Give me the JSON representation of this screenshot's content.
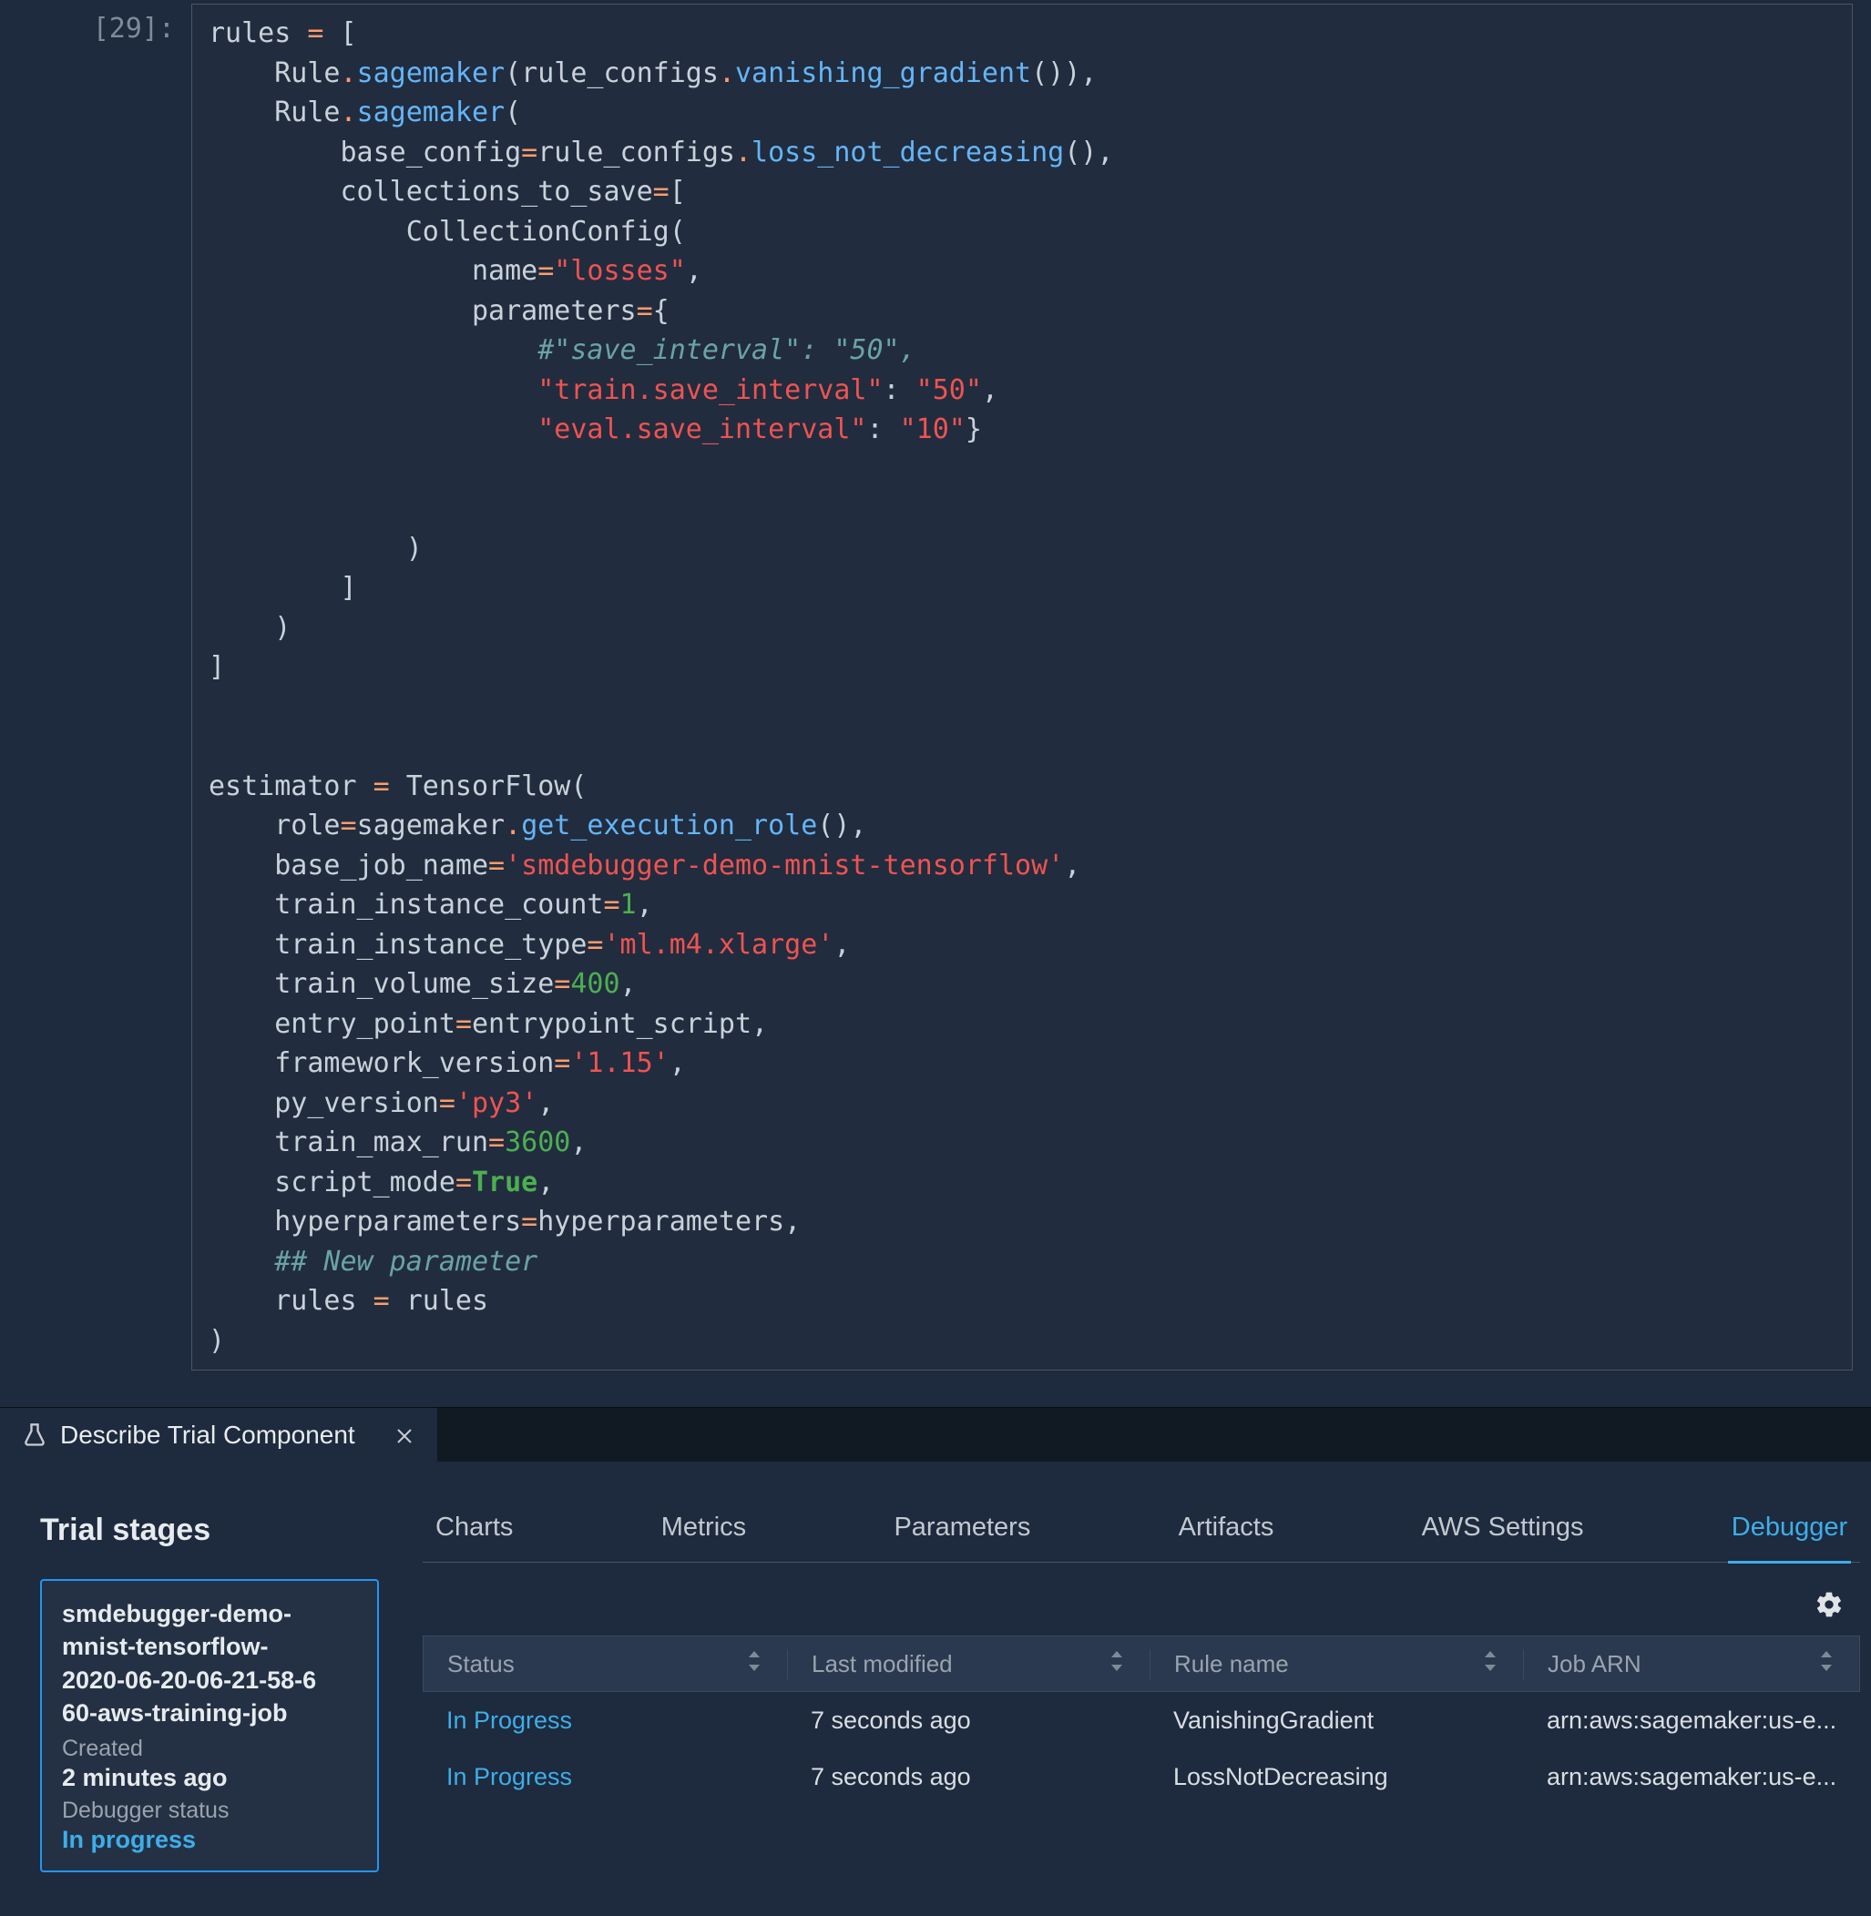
{
  "cell_prompt": "[29]:",
  "code_tokens": [
    [
      [
        "name",
        "rules "
      ],
      [
        "op",
        "="
      ],
      [
        "name",
        " ["
      ]
    ],
    [
      [
        "name",
        "    Rule"
      ],
      [
        "op",
        "."
      ],
      [
        "call",
        "sagemaker"
      ],
      [
        "name",
        "(rule_configs"
      ],
      [
        "op",
        "."
      ],
      [
        "call",
        "vanishing_gradient"
      ],
      [
        "name",
        "()),"
      ]
    ],
    [
      [
        "name",
        "    Rule"
      ],
      [
        "op",
        "."
      ],
      [
        "call",
        "sagemaker"
      ],
      [
        "name",
        "("
      ]
    ],
    [
      [
        "name",
        "        base_config"
      ],
      [
        "op",
        "="
      ],
      [
        "name",
        "rule_configs"
      ],
      [
        "op",
        "."
      ],
      [
        "call",
        "loss_not_decreasing"
      ],
      [
        "name",
        "(),"
      ]
    ],
    [
      [
        "name",
        "        collections_to_save"
      ],
      [
        "op",
        "="
      ],
      [
        "name",
        "["
      ]
    ],
    [
      [
        "name",
        "            CollectionConfig("
      ]
    ],
    [
      [
        "name",
        "                name"
      ],
      [
        "op",
        "="
      ],
      [
        "str",
        "\"losses\""
      ],
      [
        "name",
        ","
      ]
    ],
    [
      [
        "name",
        "                parameters"
      ],
      [
        "op",
        "="
      ],
      [
        "name",
        "{"
      ]
    ],
    [
      [
        "name",
        "                    "
      ],
      [
        "comment",
        "#\"save_interval\": \"50\","
      ]
    ],
    [
      [
        "name",
        "                    "
      ],
      [
        "str",
        "\"train.save_interval\""
      ],
      [
        "name",
        ": "
      ],
      [
        "str",
        "\"50\""
      ],
      [
        "name",
        ","
      ]
    ],
    [
      [
        "name",
        "                    "
      ],
      [
        "str",
        "\"eval.save_interval\""
      ],
      [
        "name",
        ": "
      ],
      [
        "str",
        "\"10\""
      ],
      [
        "name",
        "}"
      ]
    ],
    [
      [
        "name",
        ""
      ]
    ],
    [
      [
        "name",
        ""
      ]
    ],
    [
      [
        "name",
        "            )"
      ]
    ],
    [
      [
        "name",
        "        ]"
      ]
    ],
    [
      [
        "name",
        "    )"
      ]
    ],
    [
      [
        "name",
        "]"
      ]
    ],
    [
      [
        "name",
        ""
      ]
    ],
    [
      [
        "name",
        ""
      ]
    ],
    [
      [
        "name",
        "estimator "
      ],
      [
        "op",
        "="
      ],
      [
        "name",
        " TensorFlow("
      ]
    ],
    [
      [
        "name",
        "    role"
      ],
      [
        "op",
        "="
      ],
      [
        "name",
        "sagemaker"
      ],
      [
        "op",
        "."
      ],
      [
        "call",
        "get_execution_role"
      ],
      [
        "name",
        "(),"
      ]
    ],
    [
      [
        "name",
        "    base_job_name"
      ],
      [
        "op",
        "="
      ],
      [
        "str",
        "'smdebugger-demo-mnist-tensorflow'"
      ],
      [
        "name",
        ","
      ]
    ],
    [
      [
        "name",
        "    train_instance_count"
      ],
      [
        "op",
        "="
      ],
      [
        "num",
        "1"
      ],
      [
        "name",
        ","
      ]
    ],
    [
      [
        "name",
        "    train_instance_type"
      ],
      [
        "op",
        "="
      ],
      [
        "str",
        "'ml.m4.xlarge'"
      ],
      [
        "name",
        ","
      ]
    ],
    [
      [
        "name",
        "    train_volume_size"
      ],
      [
        "op",
        "="
      ],
      [
        "num",
        "400"
      ],
      [
        "name",
        ","
      ]
    ],
    [
      [
        "name",
        "    entry_point"
      ],
      [
        "op",
        "="
      ],
      [
        "name",
        "entrypoint_script,"
      ]
    ],
    [
      [
        "name",
        "    framework_version"
      ],
      [
        "op",
        "="
      ],
      [
        "str",
        "'1.15'"
      ],
      [
        "name",
        ","
      ]
    ],
    [
      [
        "name",
        "    py_version"
      ],
      [
        "op",
        "="
      ],
      [
        "str",
        "'py3'"
      ],
      [
        "name",
        ","
      ]
    ],
    [
      [
        "name",
        "    train_max_run"
      ],
      [
        "op",
        "="
      ],
      [
        "num",
        "3600"
      ],
      [
        "name",
        ","
      ]
    ],
    [
      [
        "name",
        "    script_mode"
      ],
      [
        "op",
        "="
      ],
      [
        "bool",
        "True"
      ],
      [
        "name",
        ","
      ]
    ],
    [
      [
        "name",
        "    hyperparameters"
      ],
      [
        "op",
        "="
      ],
      [
        "name",
        "hyperparameters,"
      ]
    ],
    [
      [
        "name",
        "    "
      ],
      [
        "comment",
        "## New parameter"
      ]
    ],
    [
      [
        "name",
        "    rules "
      ],
      [
        "op",
        "="
      ],
      [
        "name",
        " rules"
      ]
    ],
    [
      [
        "name",
        ")"
      ]
    ]
  ],
  "panel_tab_title": "Describe Trial Component",
  "trial_stages_label": "Trial stages",
  "stage": {
    "name": "smdebugger-demo-mnist-tensorflow-2020-06-20-06-21-58-660-aws-training-job",
    "created_label": "Created",
    "created_value": "2 minutes ago",
    "debugger_label": "Debugger status",
    "debugger_value": "In progress"
  },
  "detail_tabs": [
    "Charts",
    "Metrics",
    "Parameters",
    "Artifacts",
    "AWS Settings",
    "Debugger"
  ],
  "active_detail_tab": "Debugger",
  "table": {
    "headers": [
      "Status",
      "Last modified",
      "Rule name",
      "Job ARN"
    ],
    "rows": [
      {
        "status": "In Progress",
        "modified": "7 seconds ago",
        "rule": "VanishingGradient",
        "arn": "arn:aws:sagemaker:us-e..."
      },
      {
        "status": "In Progress",
        "modified": "7 seconds ago",
        "rule": "LossNotDecreasing",
        "arn": "arn:aws:sagemaker:us-e..."
      }
    ]
  }
}
